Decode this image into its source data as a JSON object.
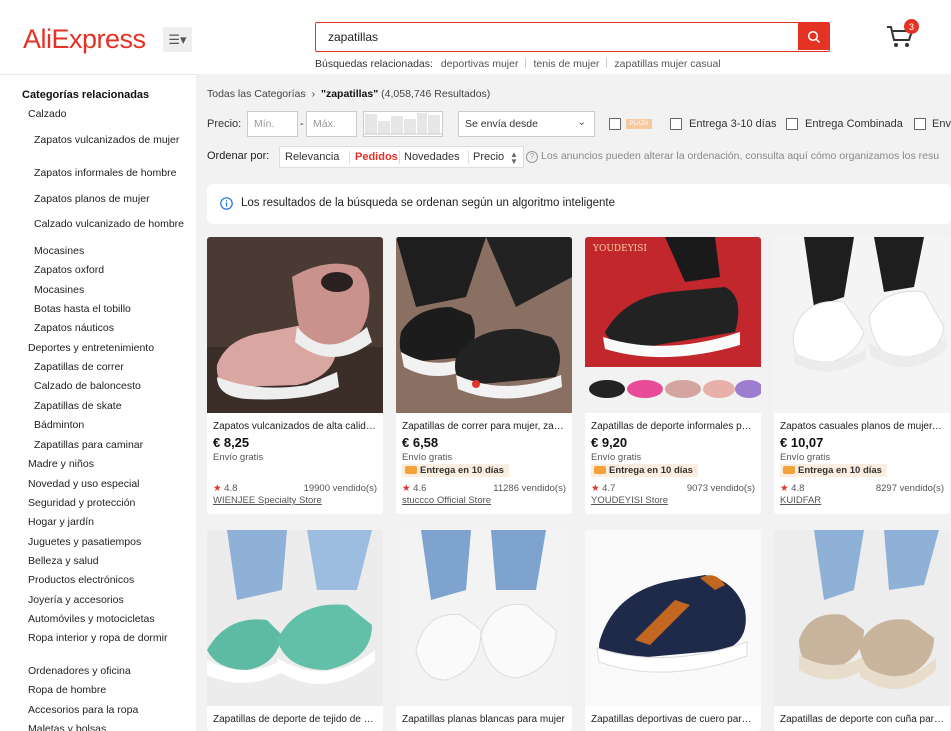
{
  "header": {
    "logo": "AliExpress",
    "search_value": "zapatillas",
    "related_label": "Búsquedas relacionadas:",
    "related": [
      "deportivas mujer",
      "tenis de mujer",
      "zapatillas mujer casual"
    ],
    "cart_count": "3"
  },
  "sidebar": {
    "title": "Categorías relacionadas",
    "items": [
      {
        "label": "Calzado",
        "level": 1
      },
      {
        "label": "Zapatos vulcanizados de mujer",
        "level": 2
      },
      {
        "label": "Zapatos informales de hombre",
        "level": 2
      },
      {
        "label": "Zapatos planos de mujer",
        "level": 2
      },
      {
        "label": "Calzado vulcanizado de hombre",
        "level": 2
      },
      {
        "label": "Mocasines",
        "level": 2
      },
      {
        "label": "Zapatos oxford",
        "level": 2
      },
      {
        "label": "Mocasines",
        "level": 2
      },
      {
        "label": "Botas hasta el tobillo",
        "level": 2
      },
      {
        "label": "Zapatos náuticos",
        "level": 2
      },
      {
        "label": "Deportes y entretenimiento",
        "level": 1
      },
      {
        "label": "Zapatillas de correr",
        "level": 2
      },
      {
        "label": "Calzado de baloncesto",
        "level": 2
      },
      {
        "label": "Zapatillas de skate",
        "level": 2
      },
      {
        "label": "Bádminton",
        "level": 2
      },
      {
        "label": "Zapatillas para caminar",
        "level": 2
      },
      {
        "label": "Madre y niños",
        "level": 1
      },
      {
        "label": "Novedad y uso especial",
        "level": 1
      },
      {
        "label": "Seguridad y protección",
        "level": 1
      },
      {
        "label": "Hogar y jardín",
        "level": 1
      },
      {
        "label": "Juguetes y pasatiempos",
        "level": 1
      },
      {
        "label": "Belleza y salud",
        "level": 1
      },
      {
        "label": "Productos electrónicos",
        "level": 1
      },
      {
        "label": "Joyería y accesorios",
        "level": 1
      },
      {
        "label": "Automóviles y motocicletas",
        "level": 1
      },
      {
        "label": "Ropa interior y ropa de dormir",
        "level": 1
      },
      {
        "label": "Ordenadores y oficina",
        "level": 1
      },
      {
        "label": "Ropa de hombre",
        "level": 1
      },
      {
        "label": "Accesorios para la ropa",
        "level": 1
      },
      {
        "label": "Maletas y bolsas",
        "level": 1
      }
    ]
  },
  "breadcrumb": {
    "root": "Todas las Categorías",
    "chevron": "›",
    "query": "\"zapatillas\"",
    "count": "(4,058,746 Resultados)"
  },
  "filters": {
    "price_label": "Precio:",
    "min_placeholder": "Mín.",
    "max_placeholder": "Máx.",
    "dash": "-",
    "ships_from": "Se envía desde",
    "plaza": "PLAZA",
    "delivery": "Entrega 3-10 días",
    "combined": "Entrega Combinada",
    "cut": "Env"
  },
  "sort": {
    "label": "Ordenar por:",
    "options": [
      "Relevancia",
      "Pedidos",
      "Novedades",
      "Precio"
    ],
    "active": "Pedidos",
    "note": "Los anuncios pueden alterar la ordenación, consulta aquí cómo organizamos los resu"
  },
  "info": {
    "text": "Los resultados de la búsqueda se ordenan según un algoritmo inteligente"
  },
  "products": [
    {
      "title": "Zapatos vulcanizados de alta calidad para mujer",
      "price": "€ 8,25",
      "shipping": "Envío gratis",
      "badge": "",
      "rating": "4.8",
      "sold": "19900 vendido(s)",
      "store": "WIENJEE Specialty Store"
    },
    {
      "title": "Zapatillas de correr para mujer, zapatos",
      "price": "€ 6,58",
      "shipping": "Envío gratis",
      "badge": "Entrega en 10 días",
      "rating": "4.6",
      "sold": "11286 vendido(s)",
      "store": "stuccco Official Store"
    },
    {
      "title": "Zapatillas de deporte informales para mujer",
      "price": "€ 9,20",
      "shipping": "Envío gratis",
      "badge": "Entrega en 10 días",
      "rating": "4.7",
      "sold": "9073 vendido(s)",
      "store": "YOUDEYISI Store"
    },
    {
      "title": "Zapatos casuales planos de mujer, zapatillas",
      "price": "€ 10,07",
      "shipping": "Envío gratis",
      "badge": "Entrega en 10 días",
      "rating": "4.8",
      "sold": "8297 vendido(s)",
      "store": "KUIDFAR"
    },
    {
      "title": "Zapatillas de deporte de tejido de malla",
      "price": "",
      "shipping": "",
      "badge": "",
      "rating": "",
      "sold": "",
      "store": ""
    },
    {
      "title": "Zapatillas planas blancas para mujer",
      "price": "",
      "shipping": "",
      "badge": "",
      "rating": "",
      "sold": "",
      "store": ""
    },
    {
      "title": "Zapatillas deportivas de cuero para hombre",
      "price": "",
      "shipping": "",
      "badge": "",
      "rating": "",
      "sold": "",
      "store": ""
    },
    {
      "title": "Zapatillas de deporte con cuña para mujer",
      "price": "",
      "shipping": "",
      "badge": "",
      "rating": "",
      "sold": "",
      "store": ""
    }
  ],
  "watermark": "YOUDEYISI",
  "colors": {
    "accent": "#e43225",
    "badge_bg": "#fbeee0",
    "page_bg": "#f2f2f2"
  }
}
